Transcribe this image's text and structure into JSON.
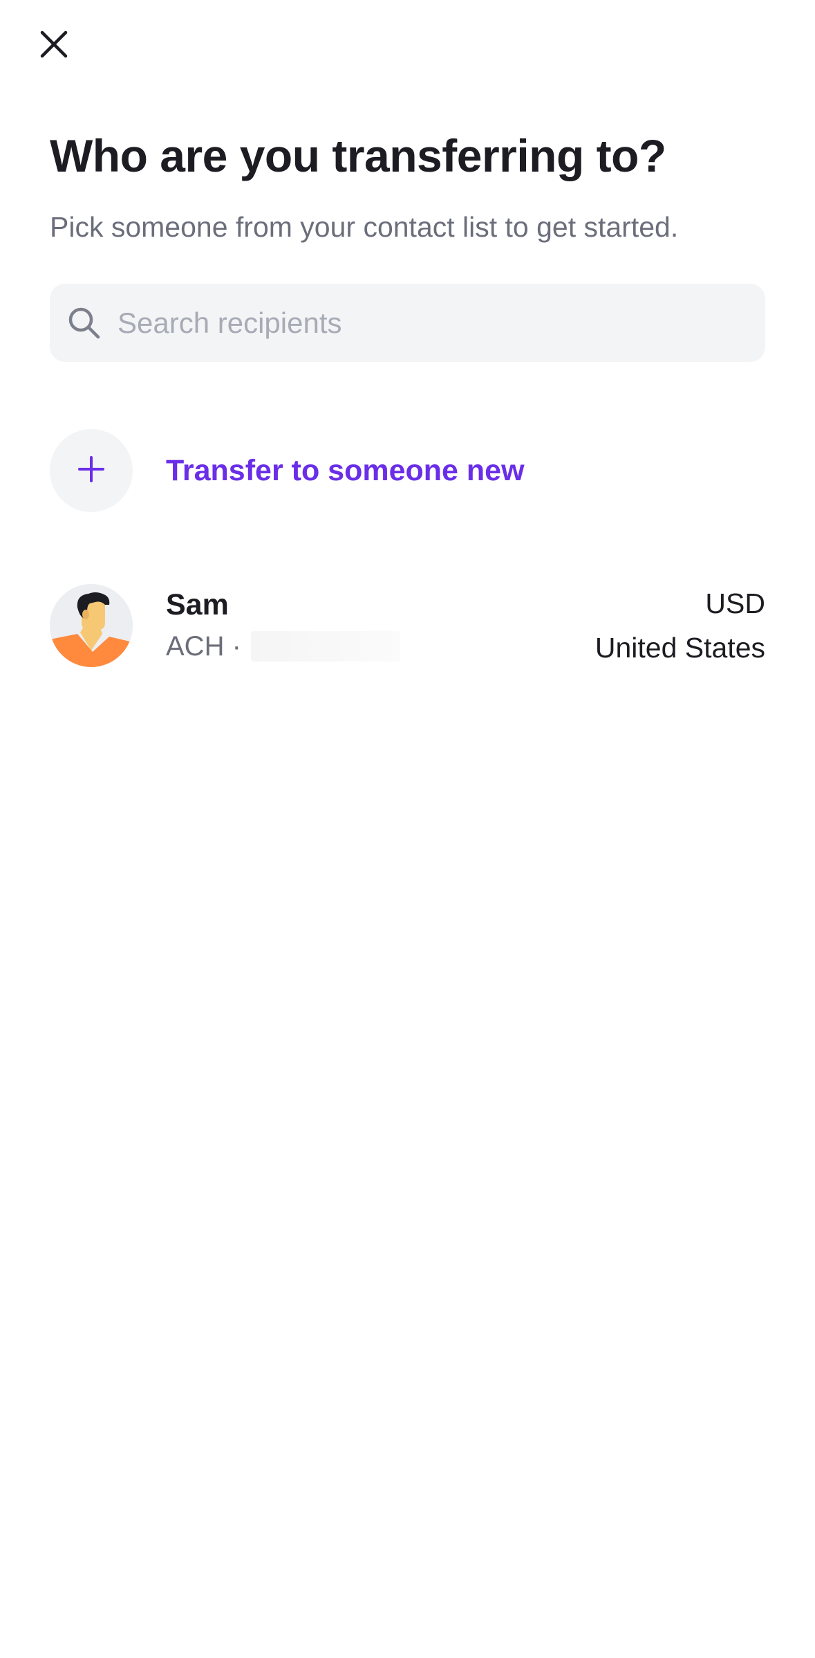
{
  "header": {
    "close_icon": "close-icon"
  },
  "title": "Who are you transferring to?",
  "subtitle": "Pick someone from your contact list to get started.",
  "search": {
    "icon": "search-icon",
    "placeholder": "Search recipients",
    "value": ""
  },
  "new_transfer": {
    "icon": "plus-icon",
    "label": "Transfer to someone new"
  },
  "recipients": [
    {
      "name": "Sam",
      "method": "ACH ·",
      "account_redacted": true,
      "currency": "USD",
      "country": "United States",
      "avatar_icon": "person-avatar-icon"
    }
  ],
  "colors": {
    "accent": "#6a2ee8",
    "title_text": "#1c1c22",
    "secondary_text": "#6b6e7a",
    "placeholder_text": "#a7abb5",
    "search_background": "#f3f4f6",
    "avatar_shirt": "#ff8a3d",
    "avatar_skin": "#f7c873",
    "avatar_hair": "#1c1c22"
  }
}
